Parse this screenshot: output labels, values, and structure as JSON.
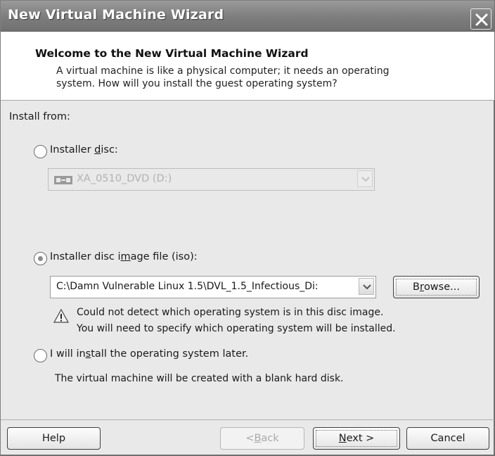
{
  "window": {
    "title": "New Virtual Machine Wizard",
    "close_icon": "close-icon"
  },
  "header": {
    "title": "Welcome to the New Virtual Machine Wizard",
    "description_line1": "A virtual machine is like a physical computer; it needs an operating",
    "description_line2": "system. How will you install the guest operating system?"
  },
  "content": {
    "install_from_label": "Install from:",
    "option_disc": {
      "label_pre": "Installer ",
      "label_mnemonic": "d",
      "label_post": "isc:",
      "selected": false,
      "drive_value": "XA_0510_DVD (D:)",
      "enabled": false
    },
    "option_iso": {
      "label_pre": "Installer disc i",
      "label_mnemonic": "m",
      "label_post": "age file (iso):",
      "selected": true,
      "path_value": "C:\\Damn Vulnerable Linux 1.5\\DVL_1.5_Infectious_Di:",
      "browse_pre": "B",
      "browse_mnemonic": "r",
      "browse_post": "owse...",
      "warning_line1": "Could not detect which operating system is in this disc image.",
      "warning_line2": "You will need to specify which operating system will be installed."
    },
    "option_later": {
      "label_pre": "I will in",
      "label_mnemonic": "s",
      "label_post": "tall the operating system later.",
      "selected": false,
      "note": "The virtual machine will be created with a blank hard disk."
    }
  },
  "footer": {
    "help_label": "Help",
    "back_pre": "< ",
    "back_mnemonic": "B",
    "back_post": "ack",
    "back_enabled": false,
    "next_mnemonic": "N",
    "next_post": "ext >",
    "cancel_label": "Cancel"
  }
}
